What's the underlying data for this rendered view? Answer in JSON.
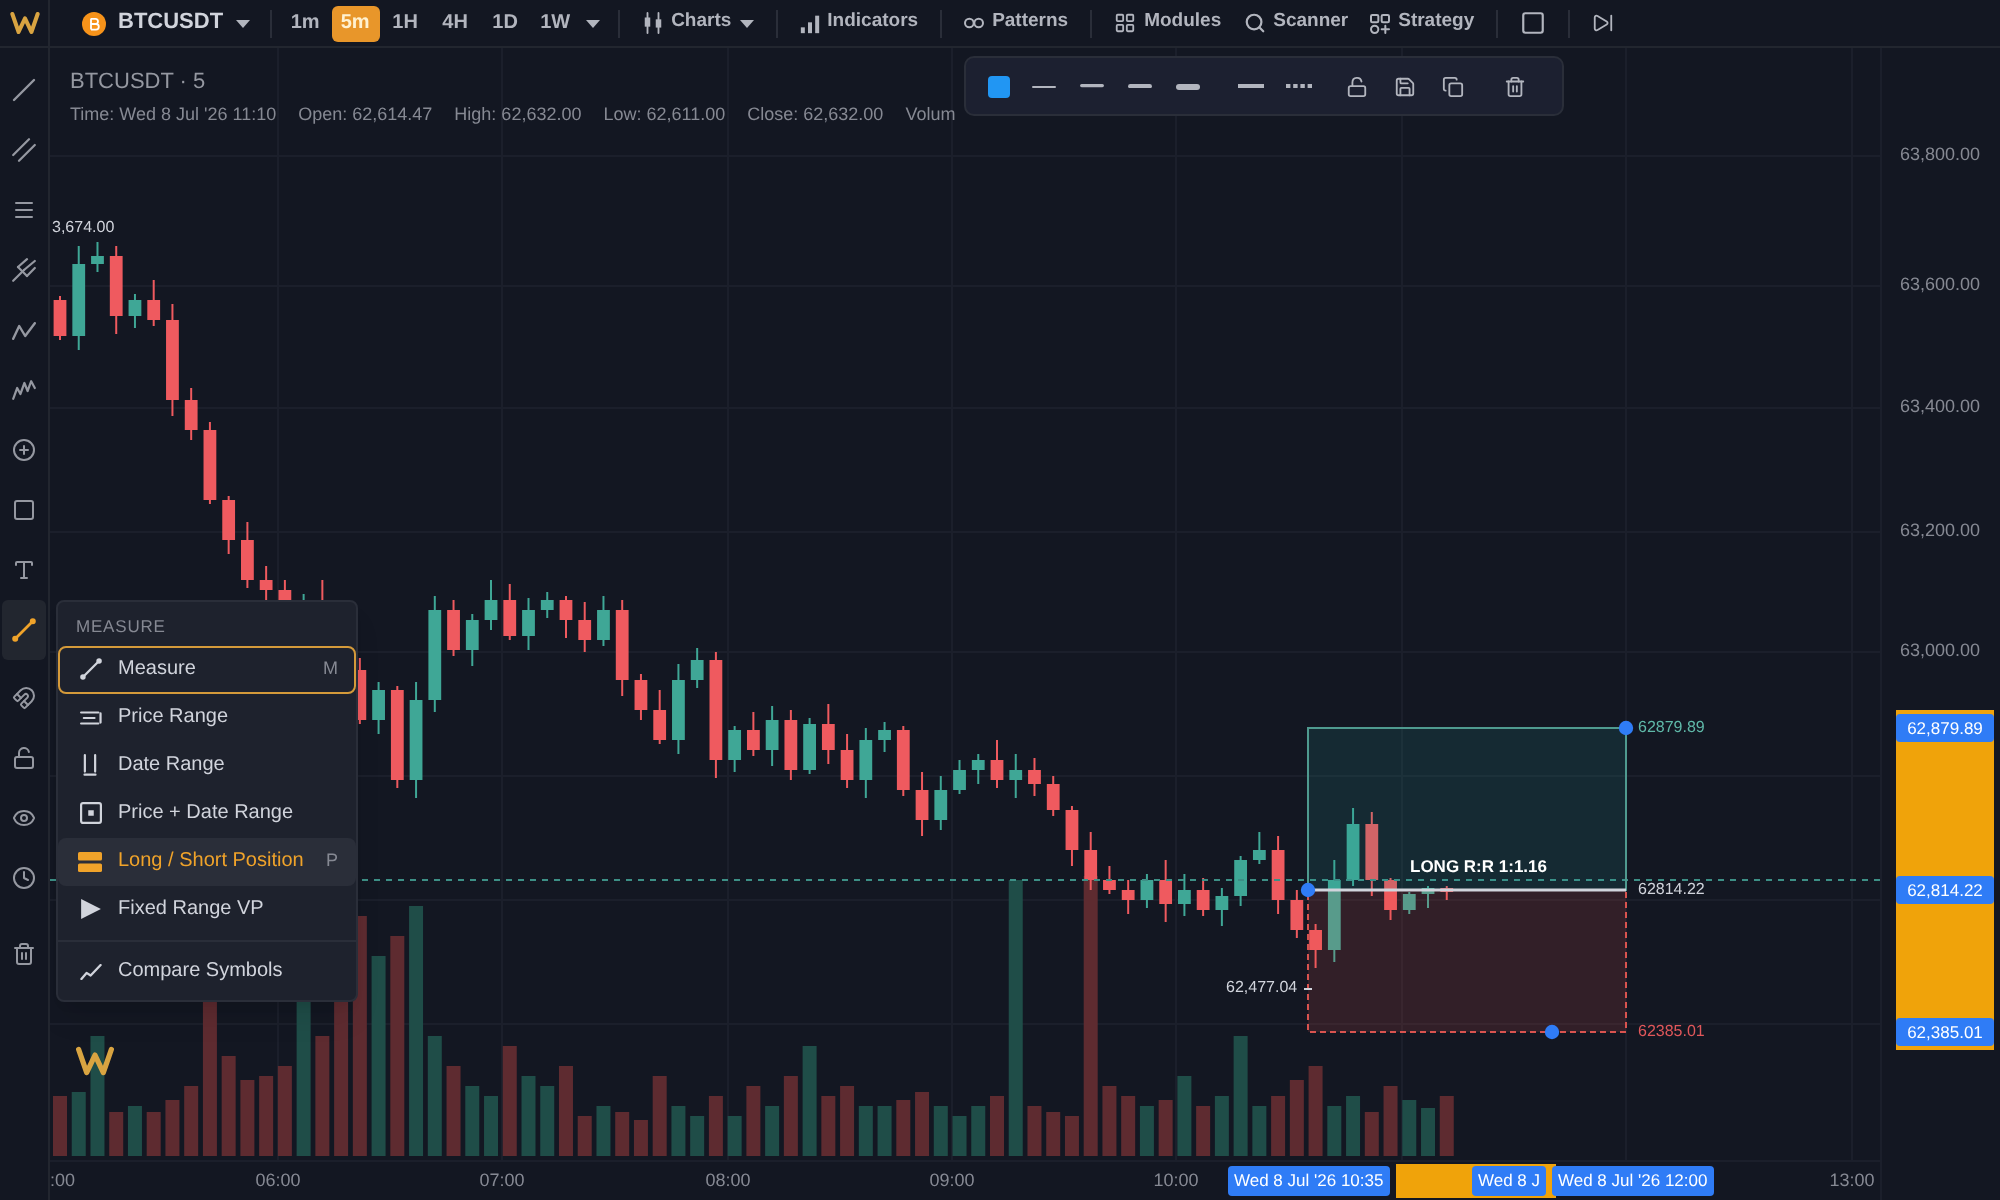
{
  "top_bar": {
    "symbol": "BTCUSDT",
    "timeframes": [
      {
        "label": "1m",
        "selected": false
      },
      {
        "label": "5m",
        "selected": true
      },
      {
        "label": "1H",
        "selected": false
      },
      {
        "label": "4H",
        "selected": false
      },
      {
        "label": "1D",
        "selected": false
      },
      {
        "label": "1W",
        "selected": false
      }
    ],
    "menus": [
      {
        "label": "Charts",
        "dropdown": true
      },
      {
        "label": "Indicators",
        "dropdown": false
      },
      {
        "label": "Patterns",
        "dropdown": false
      },
      {
        "label": "Modules",
        "dropdown": false
      },
      {
        "label": "Scanner",
        "dropdown": false
      },
      {
        "label": "Strategy",
        "dropdown": false
      }
    ]
  },
  "left_toolbar": {
    "tools": [
      {
        "active": false
      },
      {
        "active": false
      },
      {
        "active": false
      },
      {
        "active": false
      },
      {
        "active": false
      },
      {
        "active": false
      },
      {
        "active": false
      },
      {
        "active": false
      },
      {
        "active": false
      },
      {
        "active": true
      },
      {
        "active": false
      },
      {
        "active": false
      },
      {
        "active": false
      },
      {
        "active": false
      },
      {
        "active": false
      }
    ]
  },
  "chart": {
    "title": "BTCUSDT · 5",
    "legend": [
      "Time: Wed 8 Jul '26 11:10",
      "Open: 62,614.47",
      "High: 62,632.00",
      "Low: 62,611.00",
      "Close: 62,632.00",
      "Volum"
    ],
    "high_label": "3,674.00",
    "low_label": "62,477.04"
  },
  "drawing_toolbar": {
    "color": "#2196f3"
  },
  "measure_menu": {
    "title": "MEASURE",
    "items": [
      {
        "label": "Measure",
        "shortcut": "M",
        "selected": false,
        "focused": true
      },
      {
        "label": "Price Range",
        "selected": false,
        "focused": false
      },
      {
        "label": "Date Range",
        "selected": false,
        "focused": false
      },
      {
        "label": "Price + Date Range",
        "selected": false,
        "focused": false
      },
      {
        "label": "Long / Short Position",
        "shortcut": "P",
        "selected": true,
        "focused": false
      },
      {
        "label": "Fixed Range VP",
        "selected": false,
        "focused": false
      },
      {
        "label": "Compare Symbols",
        "selected": false,
        "focused": false
      }
    ]
  },
  "position": {
    "label": "LONG R:R 1:1.16",
    "target": "62879.89",
    "entry": "62814.22",
    "stop": "62385.01"
  },
  "price_axis": {
    "ticks": [
      "63,800.00",
      "63,600.00",
      "63,400.00",
      "63,200.00",
      "63,000.00"
    ],
    "markers": [
      "62,879.89",
      "62,814.22",
      "62,385.01"
    ]
  },
  "time_axis": {
    "ticks": [
      ":00",
      "06:00",
      "07:00",
      "08:00",
      "09:00",
      "10:00",
      "13:00"
    ],
    "markers": [
      "Wed 8 Jul '26 10:35",
      "Wed 8 J",
      "Wed 8 Jul '26 12:00"
    ]
  }
}
